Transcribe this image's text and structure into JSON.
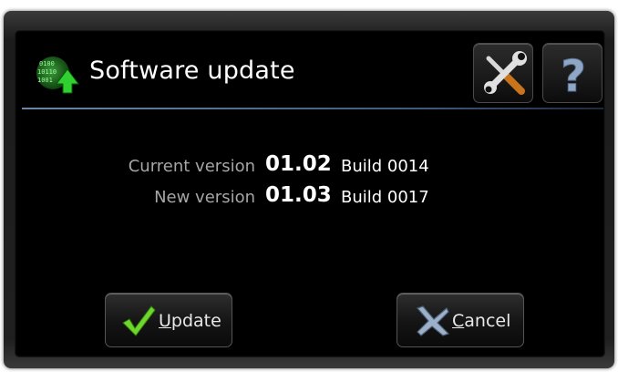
{
  "window": {
    "title": "Software update",
    "app_icon": "software-update-icon",
    "accent": "#4f6a8f"
  },
  "toolbar": {
    "settings_icon": "tools-icon",
    "help_icon": "help-icon",
    "help_glyph": "?"
  },
  "versions": {
    "current": {
      "label": "Current version",
      "number": "01.02",
      "build": "Build 0014"
    },
    "new": {
      "label": "New version",
      "number": "01.03",
      "build": "Build 0017"
    }
  },
  "actions": {
    "update": {
      "mnemonic": "U",
      "rest": "pdate",
      "icon": "checkmark-icon"
    },
    "cancel": {
      "mnemonic": "C",
      "rest": "ancel",
      "icon": "cancel-x-icon"
    }
  }
}
